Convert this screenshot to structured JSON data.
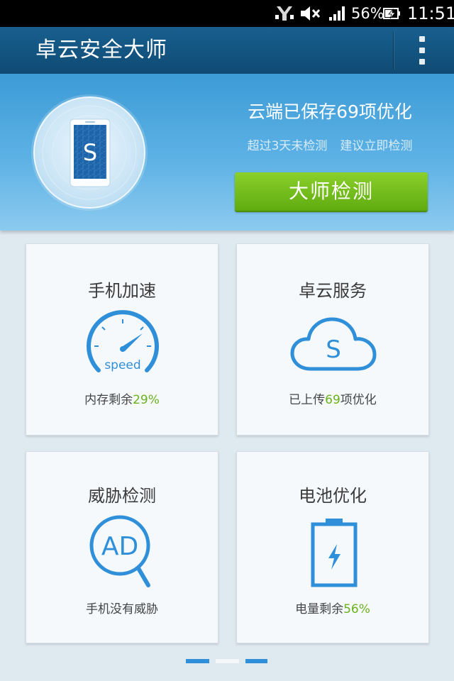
{
  "status_bar": {
    "battery_percent": "56%",
    "time": "11:51",
    "icons": [
      "notification-icon",
      "mute-icon",
      "signal-icon",
      "battery-icon"
    ]
  },
  "title_bar": {
    "title": "卓云安全大师",
    "menu_icon": "overflow-menu-icon"
  },
  "header": {
    "headline": "云端已保存69项优化",
    "sub_1": "超过3天未检测",
    "sub_2": "建议立即检测",
    "scan_button": "大师检测",
    "phone_letter": "S"
  },
  "cards": [
    {
      "title": "手机加速",
      "status_prefix": "内存剩余",
      "status_value": "29%",
      "status_suffix": "",
      "icon": "speedometer-icon",
      "icon_text": "speed"
    },
    {
      "title": "卓云服务",
      "status_prefix": "已上传",
      "status_value": "69",
      "status_suffix": "项优化",
      "icon": "cloud-icon",
      "icon_text": "S"
    },
    {
      "title": "威胁检测",
      "status_prefix": "手机没有威胁",
      "status_value": "",
      "status_suffix": "",
      "icon": "ad-scan-icon",
      "icon_text": "AD"
    },
    {
      "title": "电池优化",
      "status_prefix": "电量剩余",
      "status_value": "56%",
      "status_suffix": "",
      "icon": "battery-charging-icon",
      "icon_text": ""
    }
  ],
  "pager": {
    "pages": 3,
    "active": 0
  },
  "colors": {
    "accent_green": "#6ab21b",
    "icon_blue": "#2f8fd8",
    "title_bar": "#15587f",
    "header_top": "#3d9bd6"
  }
}
